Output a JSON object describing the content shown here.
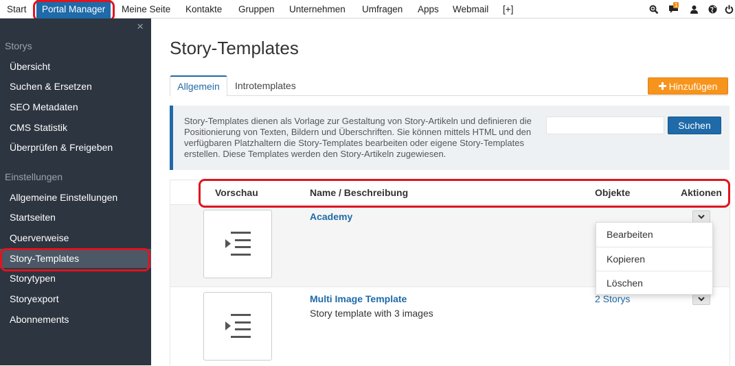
{
  "topnav": {
    "items": [
      "Start",
      "Portal Manager",
      "Meine Seite",
      "Kontakte",
      "Gruppen",
      "Unternehmen",
      "Umfragen",
      "Apps",
      "Webmail",
      "[+]"
    ],
    "badge": "1",
    "icons": [
      "search-icon",
      "chat-icon",
      "user-icon",
      "globe-icon",
      "power-icon"
    ]
  },
  "sidebar": {
    "close": "×",
    "section1": "Storys",
    "items1": [
      "Übersicht",
      "Suchen & Ersetzen",
      "SEO Metadaten",
      "CMS Statistik",
      "Überprüfen & Freigeben"
    ],
    "section2": "Einstellungen",
    "items2": [
      "Allgemeine Einstellungen",
      "Startseiten",
      "Querverweise",
      "Story-Templates",
      "Storytypen",
      "Storyexport",
      "Abonnements"
    ]
  },
  "main": {
    "title": "Story-Templates",
    "tabs": [
      "Allgemein",
      "Introtemplates"
    ],
    "add_label": "Hinzufügen",
    "info": "Story-Templates dienen als Vorlage zur Gestaltung von Story-Artikeln und definieren die Positionierung von Texten, Bildern und Überschriften. Sie können mittels HTML und den verfügbaren Platzhaltern die Story-Templates bearbeiten oder eigene Story-Templates erstellen. Diese Templates werden den Story-Artikeln zugewiesen.",
    "search_value": "",
    "search_label": "Suchen",
    "columns": [
      "Vorschau",
      "Name / Beschreibung",
      "Objekte",
      "Aktionen"
    ],
    "rows": [
      {
        "name": "Academy",
        "desc": "",
        "count": ""
      },
      {
        "name": "Multi Image Template",
        "desc": "Story template with 3 images",
        "count": "2 Storys"
      }
    ],
    "menu": [
      "Bearbeiten",
      "Kopieren",
      "Löschen"
    ]
  },
  "colors": {
    "accent": "#1f6aa8",
    "add": "#f7941d",
    "highlight": "#e0141e",
    "sidebar": "#2d3540"
  }
}
